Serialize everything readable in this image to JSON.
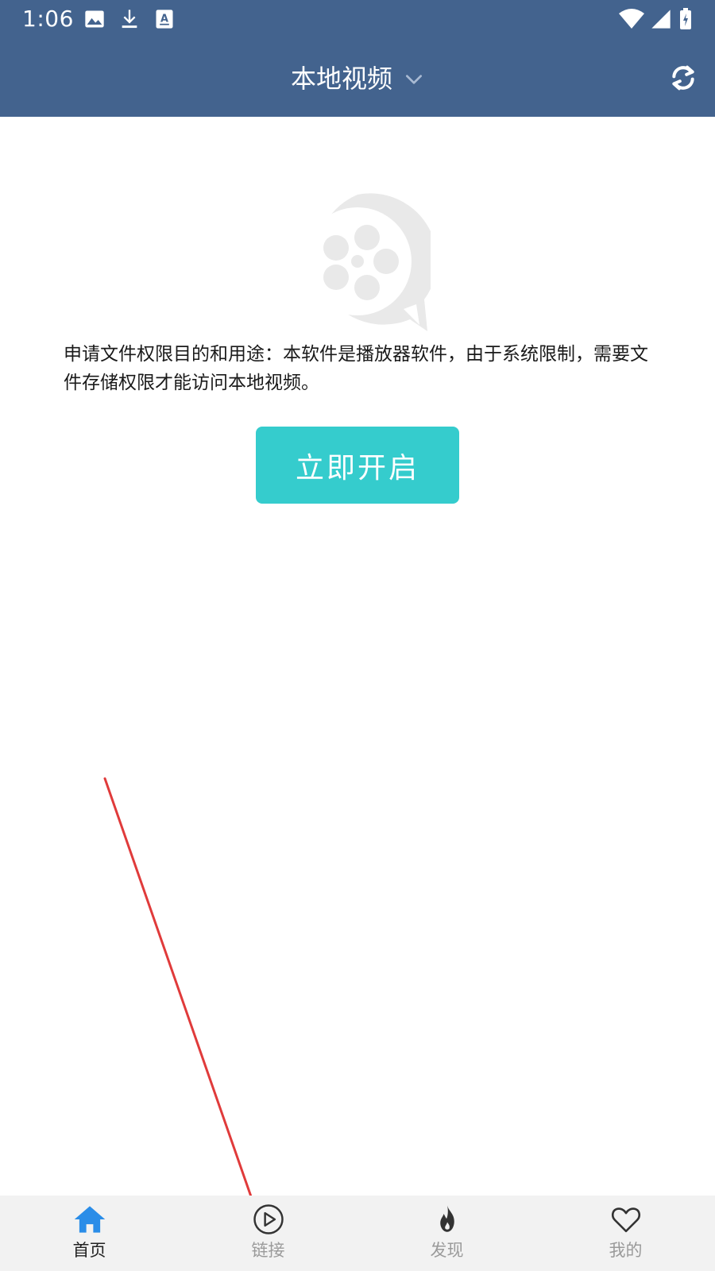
{
  "status_bar": {
    "time": "1:06",
    "icons": [
      "image-icon",
      "download-icon",
      "text-icon",
      "wifi-icon",
      "signal-icon",
      "battery-icon"
    ]
  },
  "header": {
    "title": "本地视频",
    "dropdown_icon": "chevron-down-icon",
    "refresh_icon": "refresh-icon"
  },
  "main": {
    "placeholder_icon": "video-reel-icon",
    "permission_text": "申请文件权限目的和用途：本软件是播放器软件，由于系统限制，需要文件存储权限才能访问本地视频。",
    "open_button_label": "立即开启"
  },
  "bottom_nav": {
    "items": [
      {
        "label": "首页",
        "icon": "home-icon",
        "active": true
      },
      {
        "label": "链接",
        "icon": "play-circle-icon",
        "active": false
      },
      {
        "label": "发现",
        "icon": "flame-icon",
        "active": false
      },
      {
        "label": "我的",
        "icon": "heart-icon",
        "active": false
      }
    ]
  },
  "colors": {
    "header_bg": "#43638e",
    "accent_button": "#35cccd",
    "nav_active": "#2a8de8",
    "nav_bg": "#f2f2f2",
    "annotation": "#e03b3b"
  }
}
